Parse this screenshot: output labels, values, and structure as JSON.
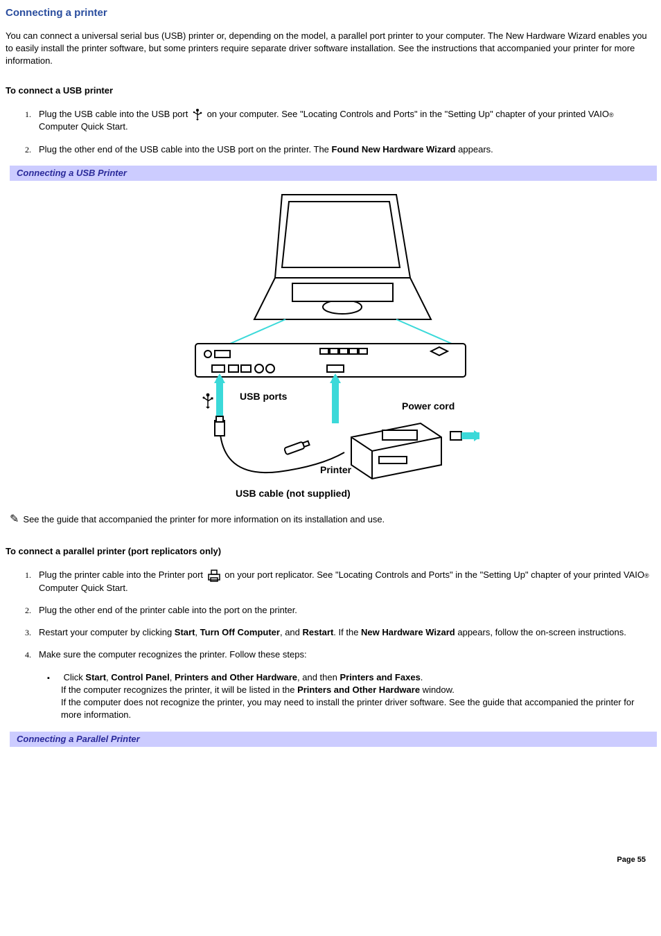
{
  "title": "Connecting a printer",
  "intro": "You can connect a universal serial bus (USB) printer or, depending on the model, a parallel port printer to your computer. The New Hardware Wizard enables you to easily install the printer software, but some printers require separate driver software installation. See the instructions that accompanied your printer for more information.",
  "usb": {
    "heading": "To connect a USB printer",
    "step1a": "Plug the USB cable into the USB port ",
    "step1b": " on your computer. See \"Locating Controls and Ports\" in the \"Setting Up\" chapter of your printed VAIO",
    "step1c": " Computer Quick Start.",
    "step2a": "Plug the other end of the USB cable into the USB port on the printer. The ",
    "step2b": "Found New Hardware Wizard",
    "step2c": " appears.",
    "figure_caption": "Connecting a USB Printer",
    "fig_labels": {
      "usb_ports": "USB ports",
      "power_cord": "Power cord",
      "printer": "Printer",
      "usb_cable": "USB cable (not supplied)"
    },
    "note": "See the guide that accompanied the printer for more information on its installation and use."
  },
  "parallel": {
    "heading": "To connect a parallel printer (port replicators only)",
    "step1a": "Plug the printer cable into the Printer port ",
    "step1b": " on your port replicator. See \"Locating Controls and Ports\" in the \"Setting Up\" chapter of your printed VAIO",
    "step1c": " Computer Quick Start.",
    "step2": "Plug the other end of the printer cable into the port on the printer.",
    "step3a": "Restart your computer by clicking ",
    "step3_start": "Start",
    "step3b": ", ",
    "step3_turnoff": "Turn Off Computer",
    "step3c": ", and ",
    "step3_restart": "Restart",
    "step3d": ". If the ",
    "step3_wizard": "New Hardware Wizard",
    "step3e": " appears, follow the on-screen instructions.",
    "step4": "Make sure the computer recognizes the printer. Follow these steps:",
    "step4_sub_a": "Click ",
    "step4_start": "Start",
    "step4_b": ", ",
    "step4_cp": "Control Panel",
    "step4_c": ", ",
    "step4_poh": "Printers and Other Hardware",
    "step4_d": ", and then ",
    "step4_pf": "Printers and Faxes",
    "step4_e": ".",
    "step4_line2a": "If the computer recognizes the printer, it will be listed in the ",
    "step4_line2b": "Printers and Other Hardware",
    "step4_line2c": " window.",
    "step4_line3": "If the computer does not recognize the printer, you may need to install the printer driver software. See the guide that accompanied the printer for more information.",
    "figure_caption": "Connecting a Parallel Printer"
  },
  "page_number": "Page 55",
  "reg_mark": "®"
}
